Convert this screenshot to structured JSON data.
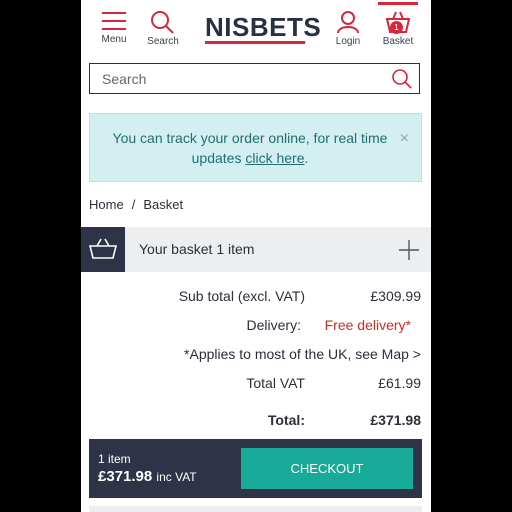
{
  "header": {
    "menu_label": "Menu",
    "search_label": "Search",
    "logo_text": "NISBETS",
    "login_label": "Login",
    "basket_label": "Basket",
    "basket_count": "1"
  },
  "search": {
    "placeholder": "Search"
  },
  "notice": {
    "message": "You can track your order online, for real time updates ",
    "link_text": "click here",
    "end": ".",
    "close": "×"
  },
  "breadcrumb": {
    "home": "Home",
    "separator": "/",
    "current": "Basket"
  },
  "basket_panel": {
    "title": "Your basket 1 item"
  },
  "summary": {
    "subtotal_label": "Sub total (excl. VAT)",
    "subtotal_value": "£309.99",
    "delivery_label": "Delivery:",
    "delivery_value": "Free delivery*",
    "delivery_note": "*Applies to most of the UK, see Map >",
    "vat_label": "Total VAT",
    "vat_value": "£61.99",
    "total_label": "Total:",
    "total_value": "£371.98"
  },
  "checkout": {
    "item_count": "1 item",
    "price": "£371.98",
    "price_suffix": "inc VAT",
    "button_label": "CHECKOUT"
  },
  "colors": {
    "brand_navy": "#283046",
    "brand_red": "#d7263d",
    "notice_bg": "#d4eff1",
    "checkout_green": "#17aa99",
    "panel_dark": "#2e3347"
  }
}
